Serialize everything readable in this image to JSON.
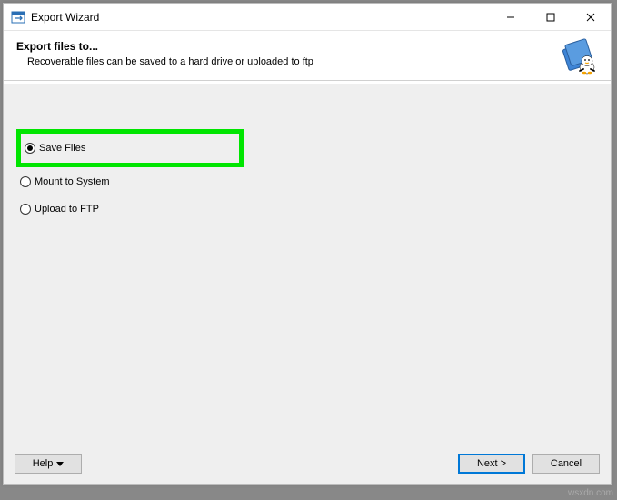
{
  "window": {
    "title": "Export Wizard"
  },
  "header": {
    "title": "Export files to...",
    "subtitle": "Recoverable files can be saved to a hard drive or uploaded to ftp"
  },
  "options": {
    "save_files": "Save Files",
    "mount_to_system": "Mount to System",
    "upload_to_ftp": "Upload to FTP"
  },
  "footer": {
    "help": "Help",
    "next": "Next  >",
    "cancel": "Cancel"
  },
  "watermark": "wsxdn.com"
}
